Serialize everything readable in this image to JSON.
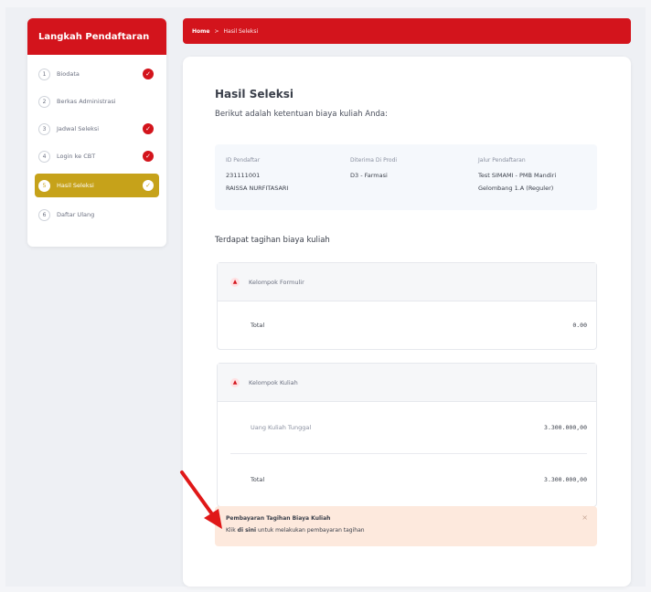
{
  "sidebar": {
    "title": "Langkah Pendaftaran",
    "steps": [
      {
        "num": "1",
        "label": "Biodata",
        "done": true
      },
      {
        "num": "2",
        "label": "Berkas Administrasi",
        "done": false
      },
      {
        "num": "3",
        "label": "Jadwal Seleksi",
        "done": true
      },
      {
        "num": "4",
        "label": "Login ke CBT",
        "done": true
      },
      {
        "num": "5",
        "label": "Hasil Seleksi",
        "done": true
      },
      {
        "num": "6",
        "label": "Daftar Ulang",
        "done": false
      }
    ]
  },
  "breadcrumb": {
    "home": "Home",
    "separator": ">",
    "current": "Hasil Seleksi"
  },
  "main": {
    "title": "Hasil Seleksi",
    "subtitle": "Berikut adalah ketentuan biaya kuliah Anda:",
    "info": {
      "id_label": "ID Pendaftar",
      "id_value": "231111001",
      "name": "RAISSA NURFITASARI",
      "prodi_label": "Diterima Di Prodi",
      "prodi_value": "D3 - Farmasi",
      "jalur_label": "Jalur Pendaftaran",
      "jalur_value": "Test SIMAMI - PMB Mandiri",
      "gelombang": "Gelombang 1.A (Reguler)"
    },
    "tagihan_heading": "Terdapat tagihan biaya kuliah",
    "groups": [
      {
        "name": "Kelompok Formulir",
        "total_label": "Total",
        "total": "0.00"
      },
      {
        "name": "Kelompok Kuliah",
        "item_label": "Uang Kuliah Tunggal",
        "item_amount": "3.300.000,00",
        "total_label": "Total",
        "total": "3.300.000,00"
      }
    ],
    "alert": {
      "title": "Pembayaran Tagihan Biaya Kuliah",
      "prefix": "Klik",
      "link": "di sini",
      "suffix": "untuk melakukan pembayaran tagihan",
      "close": "×"
    }
  },
  "colors": {
    "brand_red": "#d3141c",
    "active_gold": "#c6a21a",
    "alert_bg": "#fde9dd"
  },
  "icons": {
    "check": "check-circle-icon",
    "chevron": "chevron-up-icon",
    "arrow": "red-annotation-arrow"
  }
}
